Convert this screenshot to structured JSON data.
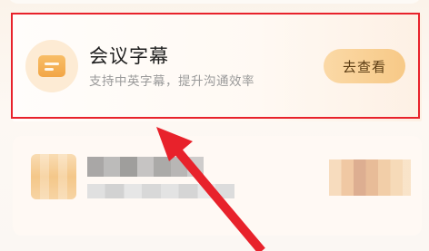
{
  "feature_card": {
    "icon": "subtitle-icon",
    "title": "会议字幕",
    "description": "支持中英字幕，提升沟通效率",
    "button_label": "去查看"
  },
  "colors": {
    "highlight_border": "#e8222b",
    "arrow": "#e8222b",
    "button_bg": "#f7c987",
    "button_text": "#5a3b12",
    "icon_bg": "#f2a646",
    "title_text": "#1f1f1f",
    "description_text": "#9a9a9a"
  }
}
